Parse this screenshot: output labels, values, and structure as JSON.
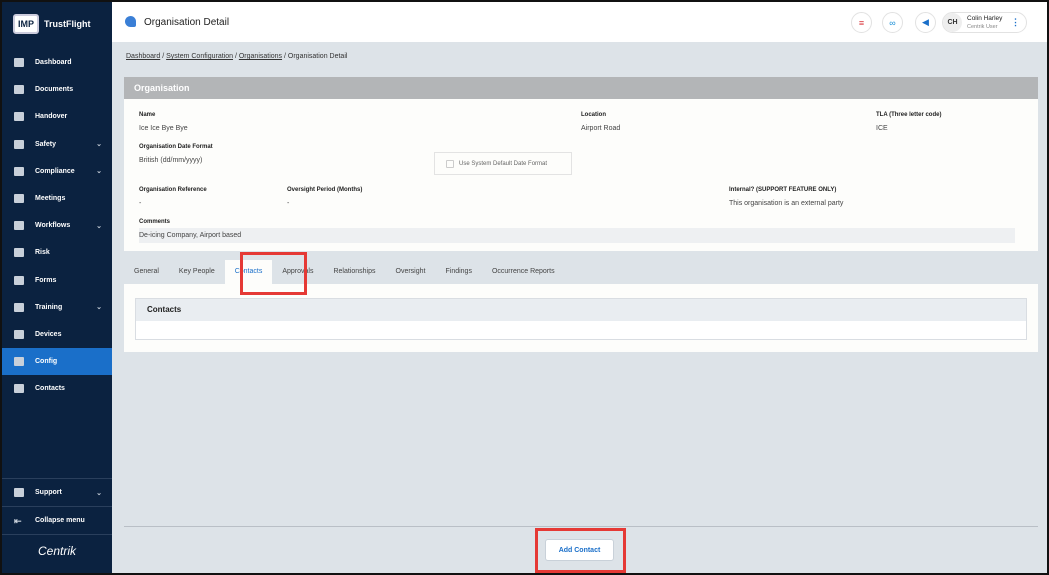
{
  "app": {
    "logo_badge": "IMP",
    "logo_text": "TrustFlight",
    "footer_logo": "Centrik"
  },
  "sidebar": {
    "items": [
      {
        "label": "Dashboard",
        "chevron": false
      },
      {
        "label": "Documents",
        "chevron": false
      },
      {
        "label": "Handover",
        "chevron": false
      },
      {
        "label": "Safety",
        "chevron": true
      },
      {
        "label": "Compliance",
        "chevron": true
      },
      {
        "label": "Meetings",
        "chevron": false
      },
      {
        "label": "Workflows",
        "chevron": true
      },
      {
        "label": "Risk",
        "chevron": false
      },
      {
        "label": "Forms",
        "chevron": false
      },
      {
        "label": "Training",
        "chevron": true
      },
      {
        "label": "Devices",
        "chevron": false
      },
      {
        "label": "Config",
        "chevron": false,
        "active": true
      },
      {
        "label": "Contacts",
        "chevron": false
      }
    ],
    "support": "Support",
    "collapse": "Collapse menu"
  },
  "header": {
    "title": "Organisation Detail",
    "user_initials": "CH",
    "user_name": "Colin Harley",
    "user_role": "Centrik User"
  },
  "breadcrumb": {
    "items": [
      "Dashboard",
      "System Configuration",
      "Organisations"
    ],
    "current": "Organisation Detail"
  },
  "organisation": {
    "title": "Organisation",
    "name_label": "Name",
    "name": "Ice Ice Bye Bye",
    "location_label": "Location",
    "location": "Airport Road",
    "tla_label": "TLA (Three letter code)",
    "tla": "ICE",
    "date_format_label": "Organisation Date Format",
    "date_format": "British (dd/mm/yyyy)",
    "default_date_checkbox": "Use System Default Date Format",
    "reference_label": "Organisation Reference",
    "reference": "-",
    "oversight_label": "Oversight Period (Months)",
    "oversight": "-",
    "internal_label": "Internal? (SUPPORT FEATURE ONLY)",
    "internal": "This organisation is an external party",
    "comments_label": "Comments",
    "comments": "De-icing Company, Airport based"
  },
  "tabs": [
    "General",
    "Key People",
    "Contacts",
    "Approvals",
    "Relationships",
    "Oversight",
    "Findings",
    "Occurrence Reports"
  ],
  "active_tab": "Contacts",
  "contacts": {
    "title": "Contacts",
    "add_button": "Add Contact"
  },
  "colors": {
    "sidebar": "#0b2240",
    "accent": "#1a6fc9",
    "highlight": "#e53935"
  }
}
